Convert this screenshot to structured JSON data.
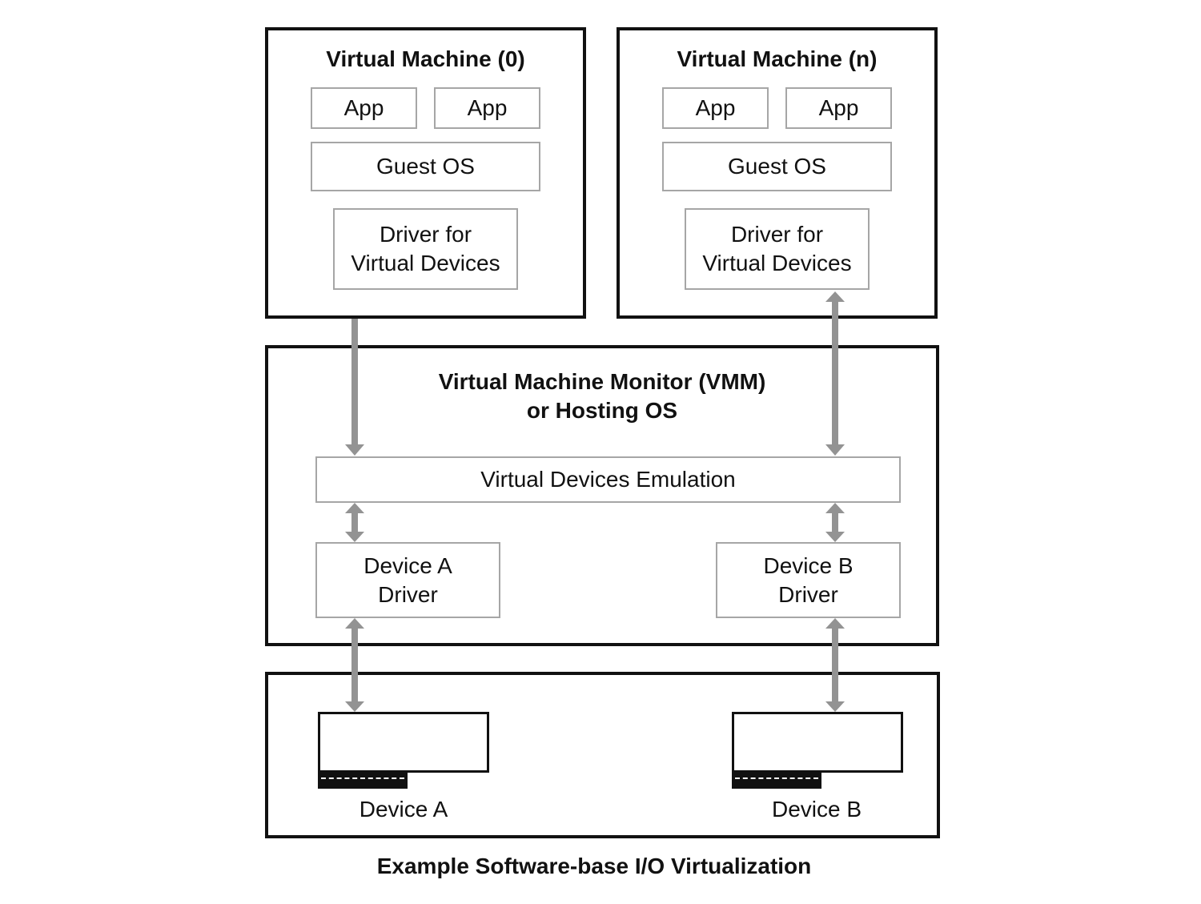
{
  "vm0": {
    "title": "Virtual Machine (0)",
    "apps": [
      "App",
      "App"
    ],
    "guest_os": "Guest OS",
    "driver_line1": "Driver for",
    "driver_line2": "Virtual Devices"
  },
  "vmn": {
    "title": "Virtual Machine (n)",
    "apps": [
      "App",
      "App"
    ],
    "guest_os": "Guest OS",
    "driver_line1": "Driver for",
    "driver_line2": "Virtual Devices"
  },
  "vmm": {
    "title_line1": "Virtual Machine Monitor (VMM)",
    "title_line2": "or Hosting OS",
    "emulation": "Virtual Devices Emulation",
    "driver_a_line1": "Device A",
    "driver_a_line2": "Driver",
    "driver_b_line1": "Device B",
    "driver_b_line2": "Driver"
  },
  "hardware": {
    "device_a": "Device A",
    "device_b": "Device B"
  },
  "caption": "Example Software-base I/O Virtualization",
  "colors": {
    "outer_border": "#111111",
    "inner_border": "#a6a6a6",
    "arrow": "#939393"
  }
}
